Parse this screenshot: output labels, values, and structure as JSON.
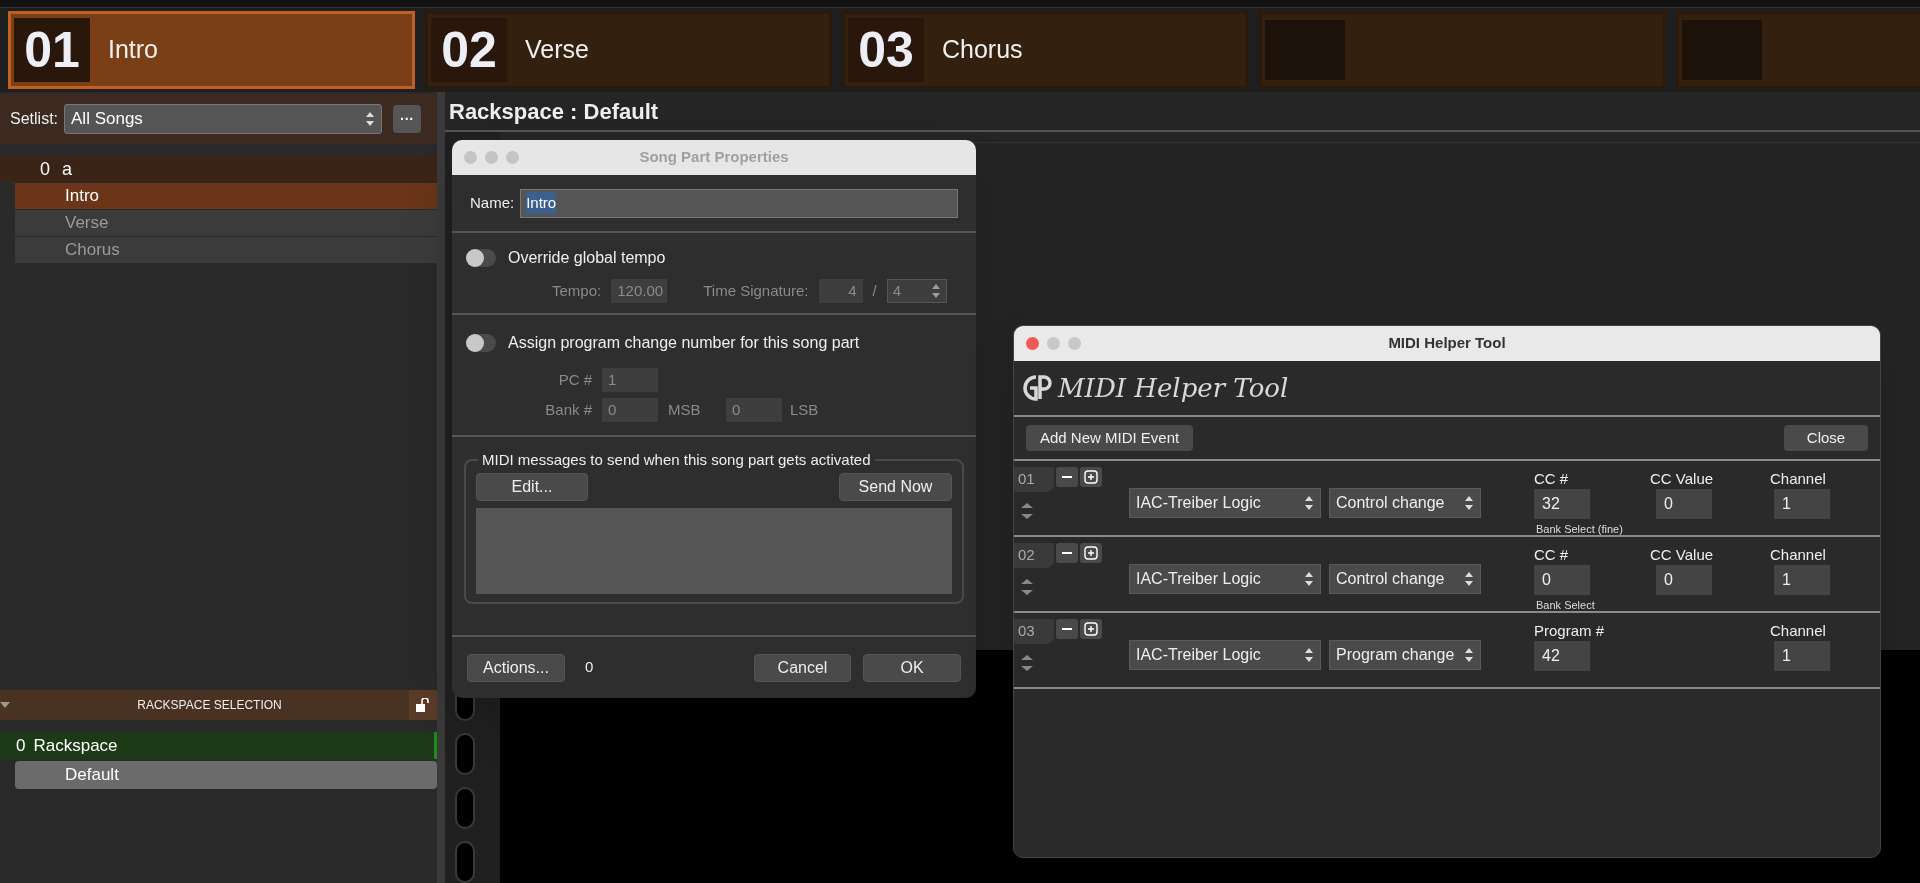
{
  "song_parts": [
    {
      "kind": "part",
      "number": "01",
      "name": "Intro",
      "selected": true
    },
    {
      "kind": "part",
      "number": "02",
      "name": "Verse",
      "selected": false
    },
    {
      "kind": "part",
      "number": "03",
      "name": "Chorus",
      "selected": false
    },
    {
      "kind": "empty",
      "selected": false
    },
    {
      "kind": "empty",
      "selected": false
    }
  ],
  "setlist": {
    "label": "Setlist:",
    "value": "All Songs",
    "more_button": "···"
  },
  "songs": [
    {
      "number": "0",
      "name": "a",
      "children": [
        {
          "name": "Intro",
          "selected": true
        },
        {
          "name": "Verse",
          "selected": false
        },
        {
          "name": "Chorus",
          "selected": false
        }
      ]
    }
  ],
  "rackspace_panel": {
    "title": "RACKSPACE SELECTION",
    "rackspaces": [
      {
        "number": "0",
        "name": "Rackspace",
        "children": [
          {
            "name": "Default",
            "selected": true
          }
        ]
      }
    ]
  },
  "main": {
    "title": "Rackspace : Default"
  },
  "song_part_dialog": {
    "title": "Song Part Properties",
    "name_label": "Name:",
    "name_value": "Intro",
    "tempo_toggle": {
      "label": "Override global tempo",
      "on": false
    },
    "tempo_label": "Tempo:",
    "tempo_value": "120.00",
    "time_signature_label": "Time Signature:",
    "time_signature_numerator": "4",
    "time_signature_separator": "/",
    "time_signature_denominator": "4",
    "program_change_toggle": {
      "label": "Assign program change number for this song part",
      "on": false
    },
    "pc_label": "PC #",
    "pc_value": "1",
    "bank_label": "Bank #",
    "msb_value": "0",
    "msb_label": "MSB",
    "lsb_value": "0",
    "lsb_label": "LSB",
    "midi_group_title": "MIDI messages to send when this song part gets activated",
    "edit_button": "Edit...",
    "send_now_button": "Send Now",
    "actions_button": "Actions...",
    "actions_count": "0",
    "cancel_button": "Cancel",
    "ok_button": "OK"
  },
  "midi_helper": {
    "title": "MIDI Helper Tool",
    "logo_text": "MIDI Helper Tool",
    "add_button": "Add New MIDI Event",
    "close_button": "Close",
    "events": [
      {
        "number": "01",
        "port": "IAC-Treiber Logic",
        "type": "Control change",
        "param": {
          "label": "CC #",
          "value": "32",
          "caption": "Bank Select (fine)"
        },
        "value": {
          "label": "CC Value",
          "value": "0"
        },
        "channel": {
          "label": "Channel",
          "value": "1"
        }
      },
      {
        "number": "02",
        "port": "IAC-Treiber Logic",
        "type": "Control change",
        "param": {
          "label": "CC #",
          "value": "0",
          "caption": "Bank Select"
        },
        "value": {
          "label": "CC Value",
          "value": "0"
        },
        "channel": {
          "label": "Channel",
          "value": "1"
        }
      },
      {
        "number": "03",
        "port": "IAC-Treiber Logic",
        "type": "Program change",
        "param": {
          "label": "Program #",
          "value": "42"
        },
        "channel": {
          "label": "Channel",
          "value": "1"
        }
      }
    ]
  }
}
